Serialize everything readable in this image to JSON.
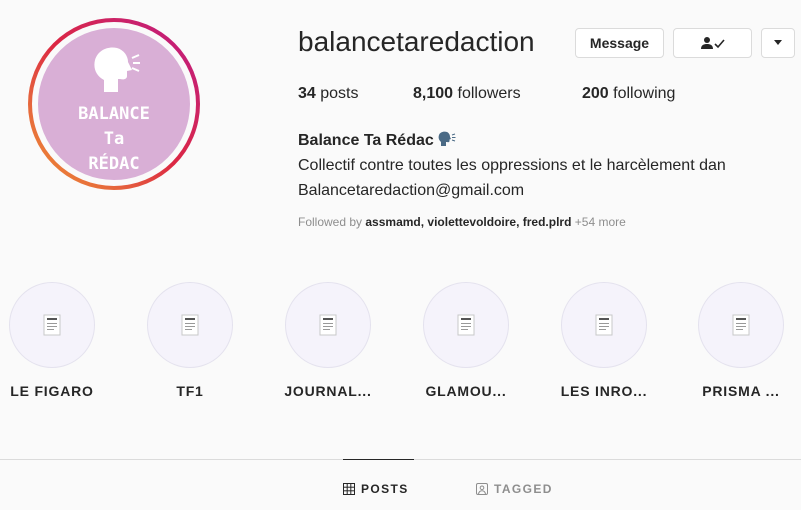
{
  "profile": {
    "avatar_text": "BALANCE\nTa\nRÉDAC",
    "username": "balancetaredaction",
    "buttons": {
      "message": "Message",
      "follow_icon": "person-check-icon",
      "more_icon": "caret-down-icon"
    },
    "stats": {
      "posts_count": "34",
      "posts_label": "posts",
      "followers_count": "8,100",
      "followers_label": "followers",
      "following_count": "200",
      "following_label": "following"
    },
    "bio": {
      "name": "Balance Ta Rédac",
      "name_icon": "speaking-head-icon",
      "description": "Collectif contre toutes les oppressions et le harcèlement dan",
      "email": "Balancetaredaction@gmail.com"
    },
    "followed_by": {
      "prefix": "Followed by",
      "users": "assmamd, violettevoldoire, fred.plrd",
      "more": "+54 more"
    }
  },
  "highlights": [
    {
      "label": "LE FIGARO"
    },
    {
      "label": "TF1"
    },
    {
      "label": "JOURNAL..."
    },
    {
      "label": "GLAMOU..."
    },
    {
      "label": "LES INRO..."
    },
    {
      "label": "PRISMA ..."
    }
  ],
  "tabs": {
    "posts": "POSTS",
    "tagged": "TAGGED"
  },
  "colors": {
    "avatar_bg": "#d9afd6",
    "text": "#262626",
    "muted": "#8e8e8e",
    "border": "#dbdbdb"
  }
}
